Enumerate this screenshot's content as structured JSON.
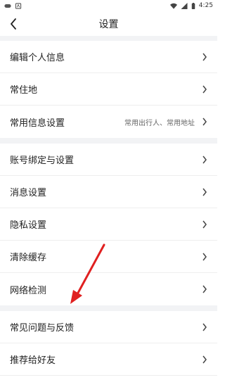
{
  "status_bar": {
    "left_icons": [
      "game-controller-icon",
      "app-notification-icon"
    ],
    "right_icons": [
      "wifi-icon",
      "signal-icon",
      "battery-icon"
    ],
    "time": "4:25"
  },
  "header": {
    "title": "设置",
    "back_icon": "back-arrow-icon"
  },
  "groups": [
    {
      "items": [
        {
          "label": "编辑个人信息",
          "value": ""
        },
        {
          "label": "常住地",
          "value": ""
        },
        {
          "label": "常用信息设置",
          "value": "常用出行人、常用地址"
        }
      ]
    },
    {
      "items": [
        {
          "label": "账号绑定与设置",
          "value": ""
        },
        {
          "label": "消息设置",
          "value": ""
        },
        {
          "label": "隐私设置",
          "value": ""
        },
        {
          "label": "清除缓存",
          "value": ""
        },
        {
          "label": "网络检测",
          "value": ""
        }
      ]
    },
    {
      "items": [
        {
          "label": "常见问题与反馈",
          "value": ""
        },
        {
          "label": "推荐给好友",
          "value": ""
        }
      ]
    }
  ],
  "annotation": {
    "color": "#e02020",
    "target": "常见问题与反馈"
  }
}
